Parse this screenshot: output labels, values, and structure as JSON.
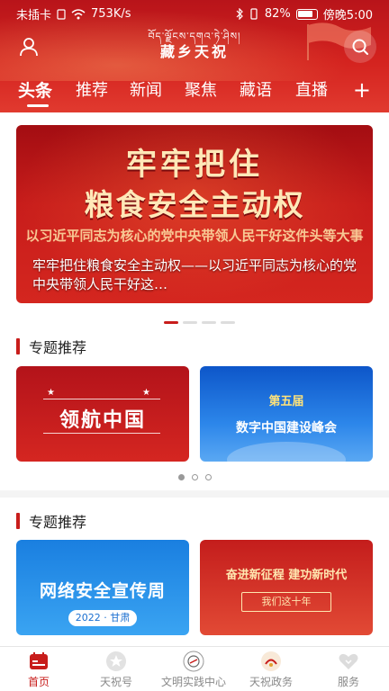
{
  "status_bar": {
    "carrier": "未插卡",
    "speed": "753K/s",
    "battery": "82%",
    "time": "傍晚5:00"
  },
  "header": {
    "logo_tibetan": "བོད་ལྗོངས་དགའ་ཏེ་ཤིས།",
    "logo_title": "藏乡天祝"
  },
  "tabs": [
    "头条",
    "推荐",
    "新闻",
    "聚焦",
    "藏语",
    "直播"
  ],
  "tabs_more": "+",
  "banner": {
    "line1": "牢牢把住",
    "line2": "粮食安全主动权",
    "sub": "以习近平同志为核心的党中央带领人民干好这件头等大事",
    "caption": "牢牢把住粮食安全主动权——以习近平同志为核心的党中央带领人民干好这…"
  },
  "section1": {
    "title": "专题推荐",
    "cards": [
      {
        "title": "领航中国"
      },
      {
        "title_top": "第五届",
        "title": "数字中国建设峰会"
      }
    ]
  },
  "section2": {
    "title": "专题推荐",
    "cards": [
      {
        "title": "网络安全宣传周",
        "sub": "2022 · 甘肃"
      },
      {
        "title": "奋进新征程 建功新时代",
        "sub": "我们这十年"
      }
    ]
  },
  "bottom_nav": [
    {
      "label": "首页",
      "icon": "home-icon",
      "active": true
    },
    {
      "label": "天祝号",
      "icon": "star-icon",
      "active": false
    },
    {
      "label": "文明实践中心",
      "icon": "emblem-icon",
      "active": false
    },
    {
      "label": "天祝政务",
      "icon": "gov-icon",
      "active": false
    },
    {
      "label": "服务",
      "icon": "heart-icon",
      "active": false
    }
  ],
  "colors": {
    "brand_red": "#c81d1b",
    "header_red": "#d4231f",
    "nav_inactive": "#8a8a8a"
  }
}
